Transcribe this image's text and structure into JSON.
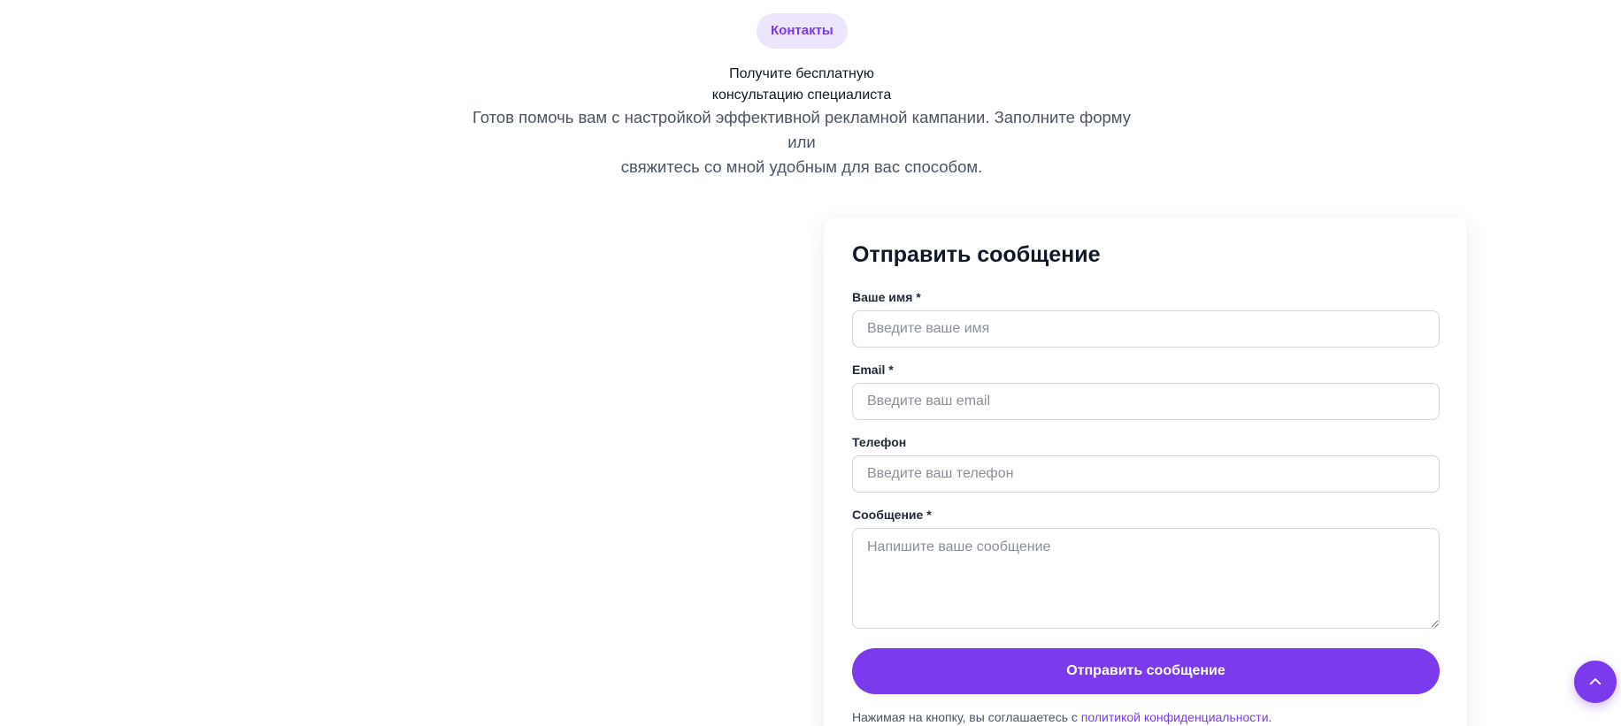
{
  "section": {
    "badge": "Контакты",
    "title_line1": "Получите бесплатную",
    "title_line2": "консультацию специалиста",
    "subtitle_line1": "Готов помочь вам с настройкой эффективной рекламной кампании. Заполните форму или",
    "subtitle_line2": "свяжитесь со мной удобным для вас способом."
  },
  "form": {
    "title": "Отправить сообщение",
    "fields": [
      {
        "label": "Ваше имя *",
        "placeholder": "Введите ваше имя",
        "value": ""
      },
      {
        "label": "Email *",
        "placeholder": "Введите ваш email",
        "value": ""
      },
      {
        "label": "Телефон",
        "placeholder": "Введите ваш телефон",
        "value": ""
      },
      {
        "label": "Сообщение *",
        "placeholder": "Напишите ваше сообщение",
        "value": ""
      }
    ],
    "submit_label": "Отправить сообщение",
    "consent_text": "Нажимая на кнопку, вы соглашаетесь с",
    "consent_link": "политикой конфиденциальности",
    "consent_end": "."
  },
  "scroll_top": {
    "icon": "chevron-up-icon"
  },
  "colors": {
    "accent": "#7c3aed",
    "badge_bg": "#ede4fd",
    "text_dark": "#111827",
    "text_muted": "#4b5563",
    "input_border": "#d1d5db"
  }
}
